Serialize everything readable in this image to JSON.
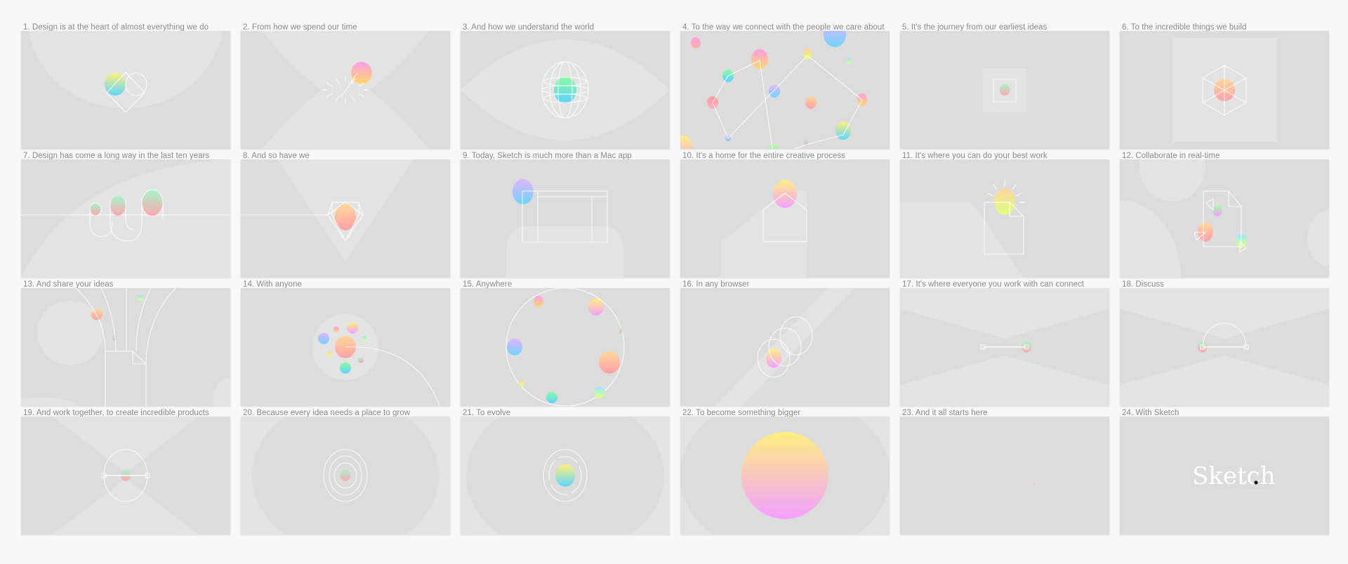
{
  "slides": [
    {
      "title": "1. Design is at the heart of almost everything we do"
    },
    {
      "title": "2. From how we spend our time"
    },
    {
      "title": "3. And how we understand the world"
    },
    {
      "title": "4. To the way we connect with the people we care about"
    },
    {
      "title": "5. It's the journey from our earliest ideas"
    },
    {
      "title": "6. To the incredible things we build"
    },
    {
      "title": "7. Design has come a long way in the last ten years"
    },
    {
      "title": "8. And so have we"
    },
    {
      "title": "9. Today, Sketch is much more than a Mac app"
    },
    {
      "title": "10. It's a home for the entire creative process"
    },
    {
      "title": "11. It's where you can do your best work"
    },
    {
      "title": "12. Collaborate in real-time"
    },
    {
      "title": "13. And share your ideas"
    },
    {
      "title": "14. With anyone"
    },
    {
      "title": "15. Anywhere"
    },
    {
      "title": "16. In any browser"
    },
    {
      "title": "17. It's where everyone you work with can connect"
    },
    {
      "title": "18. Discuss"
    },
    {
      "title": "19. And work together, to create incredible products"
    },
    {
      "title": "20. Because every idea needs a place to grow"
    },
    {
      "title": "21. To evolve"
    },
    {
      "title": "22. To become something bigger"
    },
    {
      "title": "23. And it all starts here"
    },
    {
      "title": "24. With Sketch"
    }
  ],
  "logo": {
    "wordmark": "Sketch",
    "dot": "."
  },
  "colors": {
    "page_bg": "#f8f8f8",
    "card_bg": "#dcdcdc",
    "title_text": "#8a8a8a"
  }
}
